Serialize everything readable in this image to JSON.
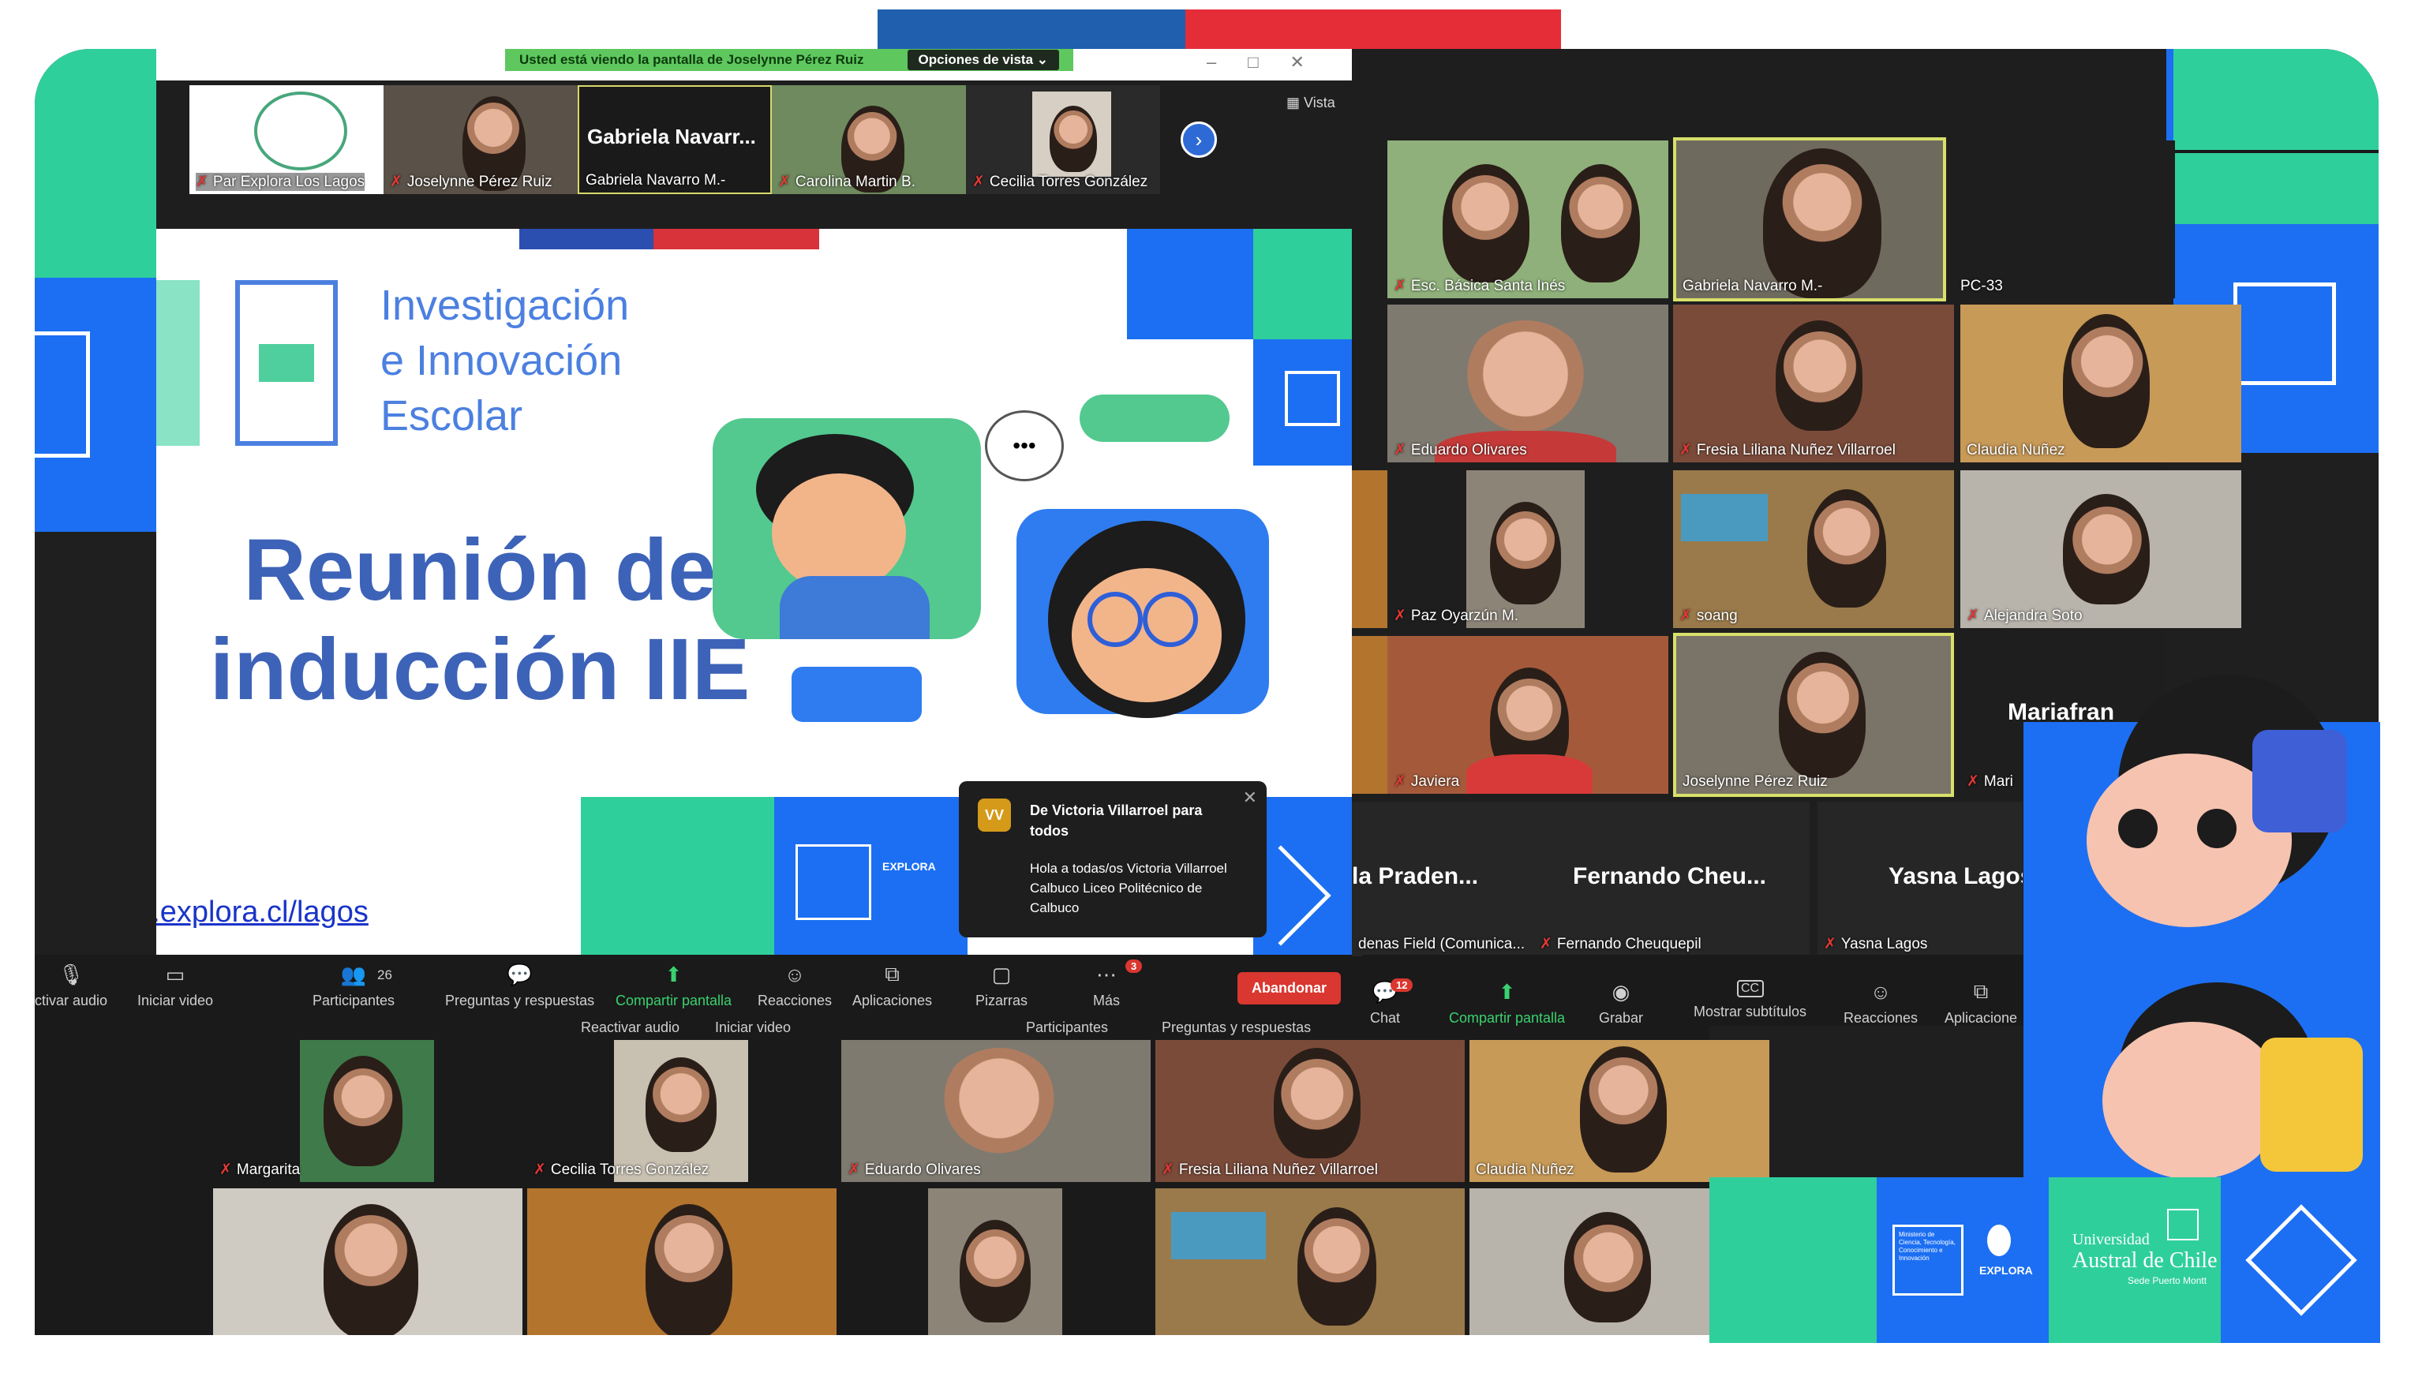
{
  "colors": {
    "flag_blue": "#1f5fad",
    "flag_red": "#e52d37",
    "accent_green": "#2fcf9c",
    "accent_blue": "#1c6ff2",
    "title_blue": "#3d63b8",
    "leave_red": "#d9372f"
  },
  "banner": {
    "viewing_text": "Usted está viendo la pantalla de Joselynne Pérez Ruiz",
    "view_options": "Opciones de vista"
  },
  "thumb_strip": {
    "view_label": "Vista",
    "items": [
      {
        "name": "Par Explora Los Lagos"
      },
      {
        "name": "Joselynne Pérez Ruiz"
      },
      {
        "name": "Gabriela Navarro M.-",
        "big_name": "Gabriela Navarr..."
      },
      {
        "name": "Carolina Martin B."
      },
      {
        "name": "Cecilia Torres González"
      }
    ]
  },
  "slide": {
    "program_lines": [
      "Investigación",
      "e Innovación",
      "Escolar"
    ],
    "title_line1": "Reunión de",
    "title_line2": "inducción IIE",
    "url": "www.explora.cl/lagos",
    "typing_dots": "•••"
  },
  "chat_popup": {
    "initials": "VV",
    "from": "De Victoria Villarroel para todos",
    "message": "Hola a todas/os Victoria Villarroel Calbuco Liceo Politécnico de Calbuco"
  },
  "toolbar_left": {
    "items": [
      {
        "label": "ctivar audio",
        "icon": "mic-off-icon"
      },
      {
        "label": "Iniciar video",
        "icon": "video-off-icon"
      },
      {
        "label": "Participantes",
        "icon": "participants-icon",
        "count": "26"
      },
      {
        "label": "Preguntas y respuestas",
        "icon": "qa-icon"
      },
      {
        "label": "Compartir pantalla",
        "icon": "share-screen-icon"
      },
      {
        "label": "Reacciones",
        "icon": "reactions-icon"
      },
      {
        "label": "Aplicaciones",
        "icon": "apps-icon"
      },
      {
        "label": "Pizarras",
        "icon": "whiteboard-icon"
      },
      {
        "label": "Más",
        "icon": "more-icon",
        "badge": "3"
      }
    ],
    "leave": "Abandonar"
  },
  "toolbar_right": {
    "secondary": [
      "Reactivar audio",
      "Iniciar video",
      "Participantes",
      "Preguntas y respuestas"
    ],
    "items": [
      {
        "label": "Chat",
        "badge": "12"
      },
      {
        "label": "Compartir pantalla"
      },
      {
        "label": "Grabar"
      },
      {
        "label": "Mostrar subtítulos",
        "icon_text": "CC"
      },
      {
        "label": "Reacciones"
      },
      {
        "label": "Aplicacione"
      }
    ]
  },
  "gallery_top": {
    "tiles": [
      {
        "name": "Esc. Básica Santa Inés"
      },
      {
        "name": "Gabriela Navarro M.-"
      },
      {
        "name": "PC-33"
      },
      {
        "name": "Eduardo Olivares"
      },
      {
        "name": "Fresia Liliana Nuñez Villarroel"
      },
      {
        "name": "Claudia Nuñez"
      },
      {
        "name": "Paz Oyarzún M."
      },
      {
        "name": "soang"
      },
      {
        "name": "Alejandra Soto"
      },
      {
        "name": "Javiera"
      },
      {
        "name": "Joselynne Pérez Ruiz"
      },
      {
        "name": "Mari",
        "big_name": "Mariafran"
      }
    ],
    "name_only": [
      {
        "big": "la Praden...",
        "small": "denas Field (Comunica..."
      },
      {
        "big": "Fernando Cheu...",
        "small": "Fernando Cheuquepil"
      },
      {
        "big": "Yasna Lagos",
        "small": "Yasna Lagos"
      }
    ]
  },
  "gallery_bottom": {
    "tiles": [
      {
        "name": "Margarita"
      },
      {
        "name": "Cecilia Torres González"
      },
      {
        "name": "Eduardo Olivares"
      },
      {
        "name": "Fresia Liliana Nuñez Villarroel"
      },
      {
        "name": "Claudia Nuñez"
      }
    ]
  },
  "logos": {
    "ministry": "Ministerio de Ciencia, Tecnología, Conocimiento e Innovación",
    "explora": "EXPLORA",
    "university_line1": "Universidad",
    "university_line2": "Austral de Chile",
    "university_line3": "Sede Puerto Montt"
  }
}
